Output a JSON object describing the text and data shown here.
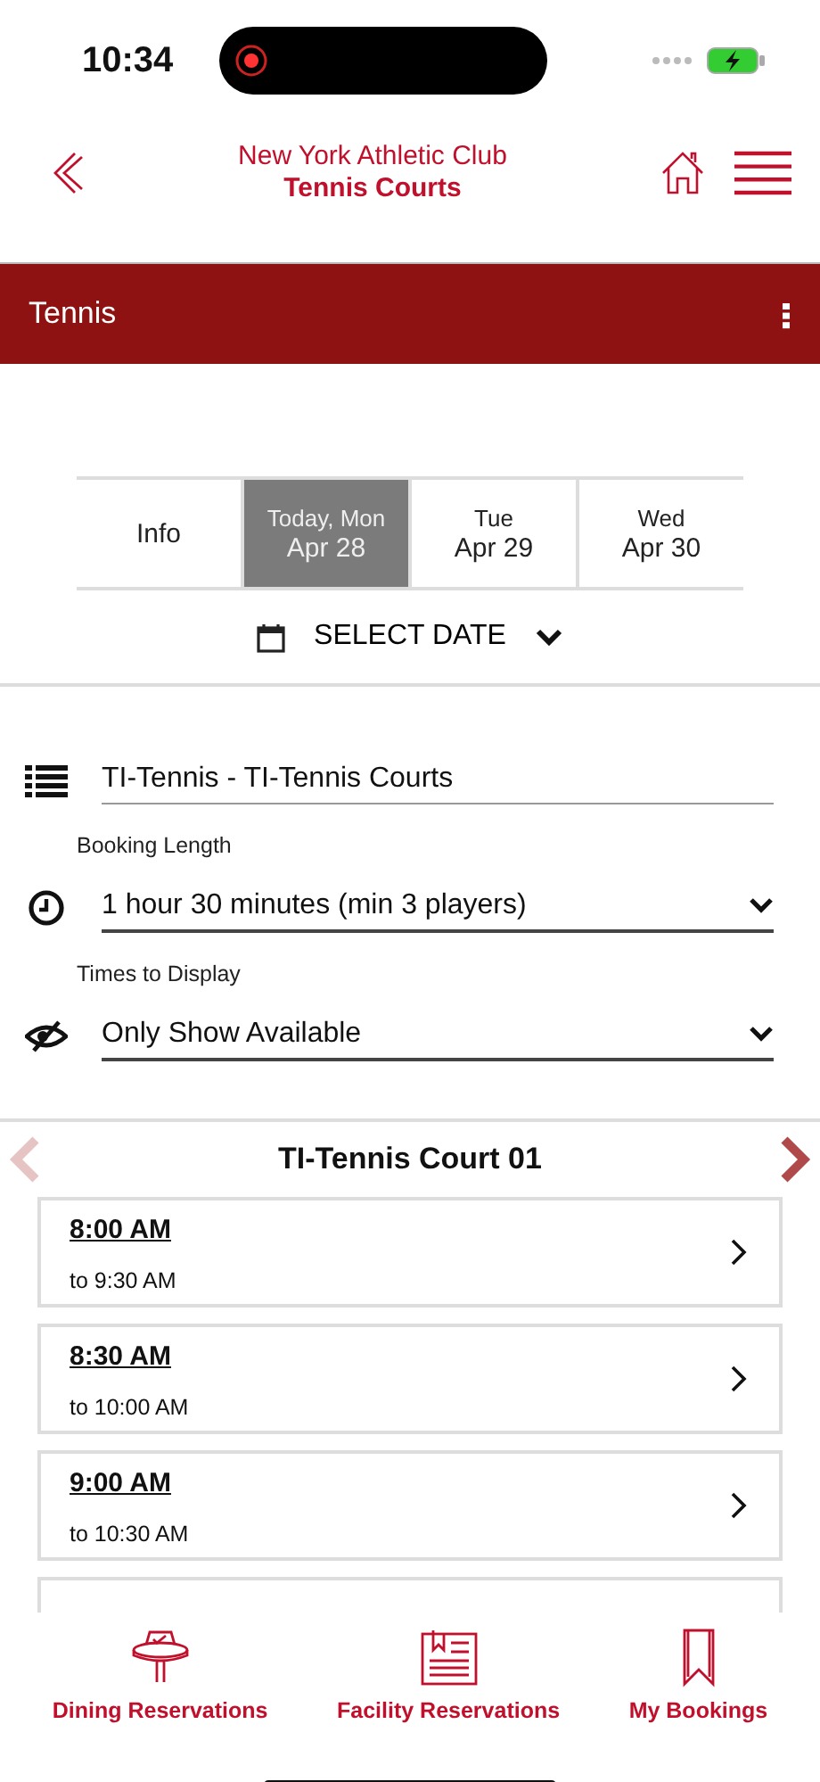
{
  "status_bar": {
    "time": "10:34"
  },
  "header": {
    "club": "New York Athletic Club",
    "title": "Tennis Courts"
  },
  "section_bar": {
    "title": "Tennis"
  },
  "date_tabs": [
    {
      "kind": "info",
      "label": "Info",
      "selected": false
    },
    {
      "kind": "date",
      "day": "Today, Mon",
      "date": "Apr 28",
      "selected": true
    },
    {
      "kind": "date",
      "day": "Tue",
      "date": "Apr 29",
      "selected": false
    },
    {
      "kind": "date",
      "day": "Wed",
      "date": "Apr 30",
      "selected": false
    }
  ],
  "select_date": "SELECT DATE",
  "fields": [
    {
      "kind": "facility",
      "value": "TI-Tennis - TI-Tennis Courts"
    },
    {
      "kind": "duration",
      "label": "Booking Length",
      "value": "1 hour 30 minutes (min 3 players)"
    },
    {
      "kind": "visibility",
      "label": "Times to Display",
      "value": "Only Show Available"
    }
  ],
  "court": {
    "name": "TI-Tennis Court 01",
    "prev_disabled": true,
    "next_disabled": false
  },
  "slots": [
    {
      "start": "8:00 AM",
      "end": "to 9:30 AM"
    },
    {
      "start": "8:30 AM",
      "end": "to 10:00 AM"
    },
    {
      "start": "9:00 AM",
      "end": "to 10:30 AM"
    }
  ],
  "bottom_nav": [
    {
      "kind": "dining",
      "label": "Dining Reservations"
    },
    {
      "kind": "facility",
      "label": "Facility Reservations"
    },
    {
      "kind": "bookings",
      "label": "My Bookings"
    }
  ]
}
